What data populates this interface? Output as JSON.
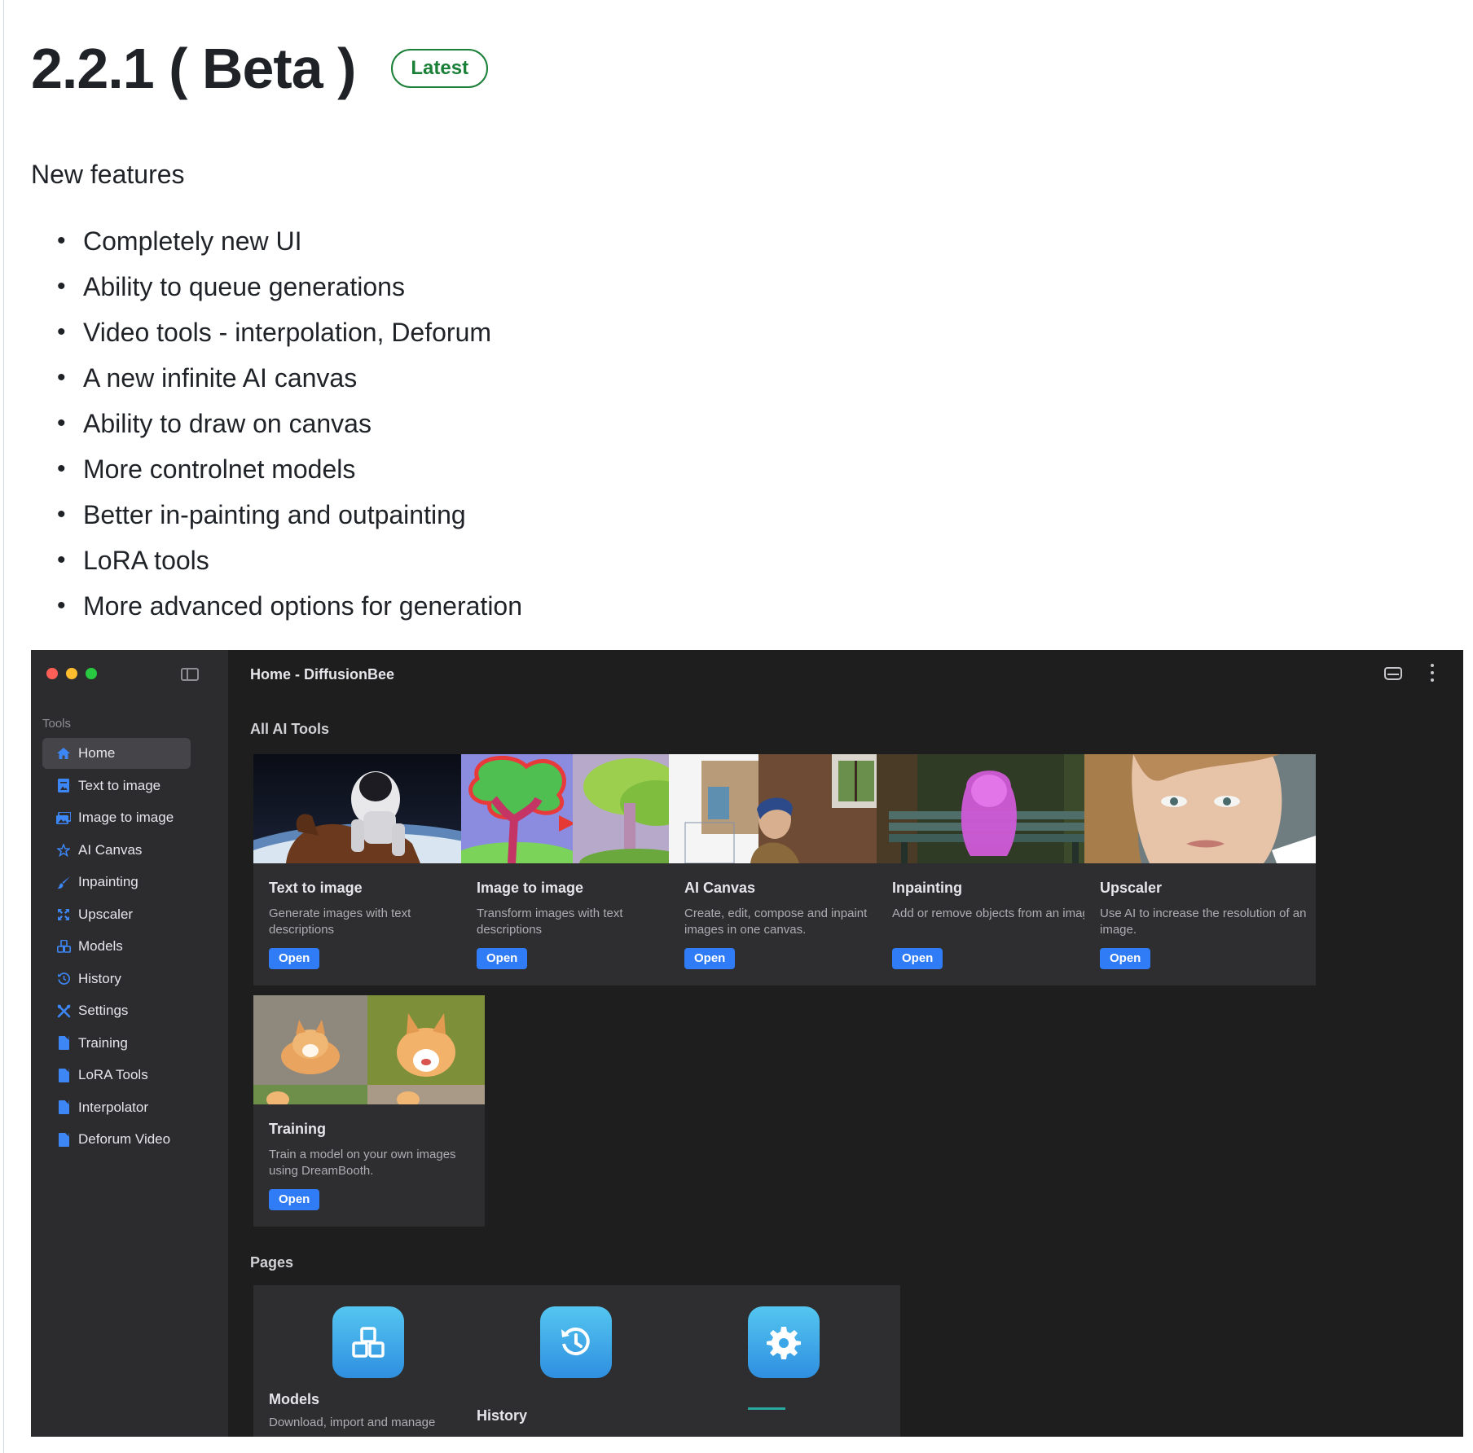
{
  "release": {
    "title": "2.2.1 ( Beta )",
    "badge": "Latest",
    "section_label": "New features",
    "features": [
      "Completely new UI",
      "Ability to queue generations",
      "Video tools - interpolation, Deforum",
      "A new infinite AI canvas",
      "Ability to draw on canvas",
      "More controlnet models",
      "Better in-painting and outpainting",
      "LoRA tools",
      "More advanced options for generation"
    ]
  },
  "app": {
    "window_title": "Home - DiffusionBee",
    "sidebar": {
      "section_label": "Tools",
      "items": [
        {
          "label": "Home",
          "icon": "home-icon",
          "active": true
        },
        {
          "label": "Text to image",
          "icon": "text-image-icon"
        },
        {
          "label": "Image to image",
          "icon": "images-icon"
        },
        {
          "label": "AI Canvas",
          "icon": "star-icon"
        },
        {
          "label": "Inpainting",
          "icon": "brush-icon"
        },
        {
          "label": "Upscaler",
          "icon": "expand-icon"
        },
        {
          "label": "Models",
          "icon": "cubes-icon"
        },
        {
          "label": "History",
          "icon": "history-icon"
        },
        {
          "label": "Settings",
          "icon": "tools-icon"
        },
        {
          "label": "Training",
          "icon": "document-icon"
        },
        {
          "label": "LoRA Tools",
          "icon": "document-icon"
        },
        {
          "label": "Interpolator",
          "icon": "document-icon"
        },
        {
          "label": "Deforum Video",
          "icon": "document-icon"
        }
      ]
    },
    "all_tools_label": "All AI Tools",
    "tools": [
      {
        "title": "Text to image",
        "desc": "Generate images with text descriptions",
        "button": "Open",
        "image": "astronaut-horse-image"
      },
      {
        "title": "Image to image",
        "desc": "Transform images with text descriptions",
        "button": "Open",
        "image": "tree-sketch-image"
      },
      {
        "title": "AI Canvas",
        "desc": "Create, edit, compose and inpaint images in one canvas.",
        "button": "Open",
        "image": "pearl-earring-canvas-image"
      },
      {
        "title": "Inpainting",
        "desc": "Add or remove objects from an image",
        "button": "Open",
        "image": "bench-dog-image"
      },
      {
        "title": "Upscaler",
        "desc": "Use AI to increase the resolution of an image.",
        "button": "Open",
        "image": "woman-portrait-image"
      },
      {
        "title": "Training",
        "desc": "Train a model on your own images using DreamBooth.",
        "button": "Open",
        "image": "corgi-grid-image"
      }
    ],
    "pages_label": "Pages",
    "pages": [
      {
        "title": "Models",
        "desc": "Download, import and manage",
        "icon": "cubes-icon"
      },
      {
        "title": "History",
        "desc": "",
        "icon": "history-icon"
      },
      {
        "title": "",
        "desc": "",
        "icon": "gear-icon"
      }
    ],
    "colors": {
      "accent": "#2f7cf6",
      "badge": "#1a7f37",
      "app_bg": "#1e1e1e",
      "sidebar_bg": "#2c2c2e"
    }
  }
}
